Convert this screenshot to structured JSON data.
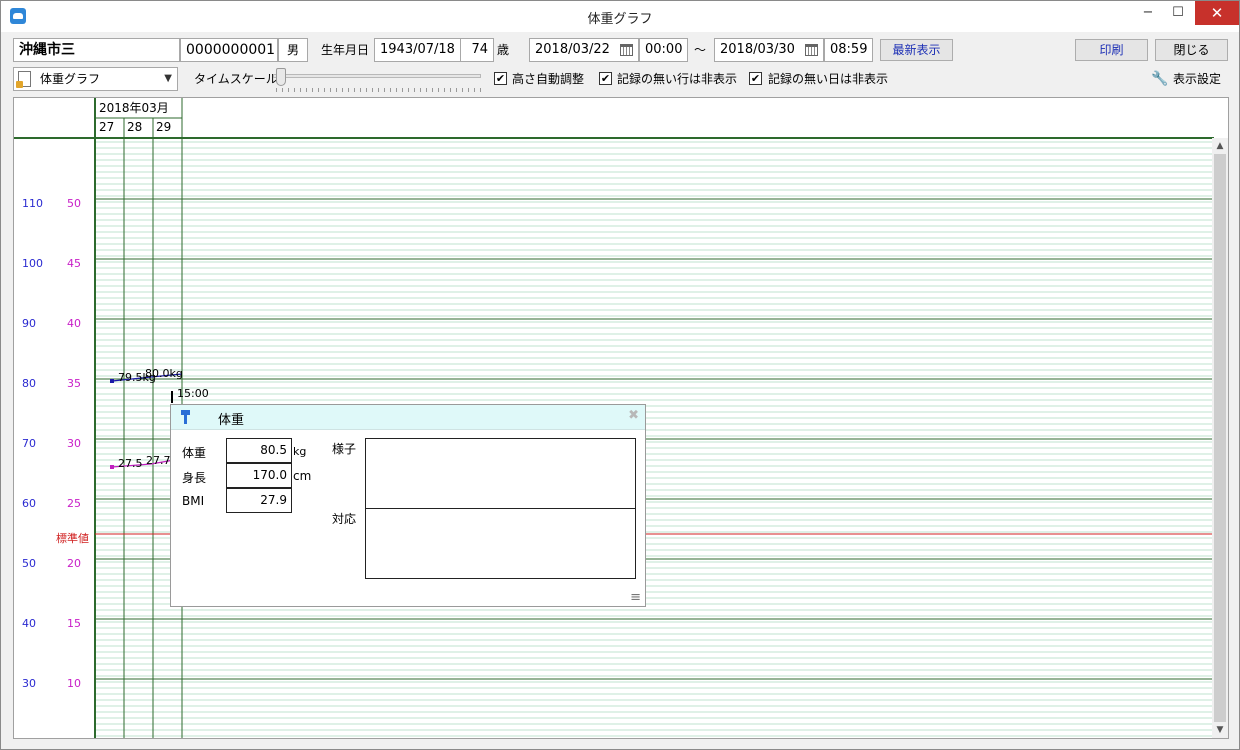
{
  "window": {
    "title": "体重グラフ",
    "minimize_glyph": "−",
    "maximize_glyph": "☐",
    "close_glyph": "✕"
  },
  "patient": {
    "name": "沖縄市三",
    "id": "0000000001",
    "sex": "男",
    "birth_label": "生年月日",
    "birth_date": "1943/07/18",
    "age": "74",
    "age_unit": "歳"
  },
  "range": {
    "start_date": "2018/03/22",
    "start_time": "00:00",
    "separator": "〜",
    "end_date": "2018/03/30",
    "end_time": "08:59"
  },
  "toolbar": {
    "refresh_label": "最新表示",
    "print_label": "印刷",
    "close_label": "閉じる",
    "view_select": "体重グラフ",
    "timescale_label": "タイムスケール",
    "auto_height_label": "高さ自動調整",
    "hide_empty_rows_label": "記録の無い行は非表示",
    "hide_empty_days_label": "記録の無い日は非表示",
    "display_settings_label": "表示設定"
  },
  "checkboxes": {
    "auto_height": true,
    "hide_empty_rows": true,
    "hide_empty_days": true
  },
  "chart": {
    "month_label": "2018年03月",
    "days": [
      "27",
      "28",
      "29"
    ],
    "left_axis": [
      "110",
      "100",
      "90",
      "80",
      "70",
      "60",
      "50",
      "40",
      "30"
    ],
    "right_axis": [
      "50",
      "45",
      "40",
      "35",
      "30",
      "25",
      "20",
      "15",
      "10"
    ],
    "standard_label": "標準値",
    "point_labels": {
      "weight_1": "79.5kg",
      "weight_2": "80.0kg",
      "bmi_1": "27.5",
      "bmi_2": "27.7"
    },
    "time_marker": "15:00",
    "colors": {
      "weight": "#1a1aa8",
      "bmi": "#c020c0",
      "standard": "#d02020",
      "major_grid": "#2d6a2d",
      "minor_grid": "#bfe3cf",
      "left_axis": "#2a2ad0",
      "right_axis": "#c81fc8"
    }
  },
  "popup": {
    "title": "体重",
    "close_glyph": "✖",
    "weight_label": "体重",
    "weight_value": "80.5",
    "weight_unit": "kg",
    "height_label": "身長",
    "height_value": "170.0",
    "height_unit": "cm",
    "bmi_label": "BMI",
    "bmi_value": "27.9",
    "condition_label": "様子",
    "response_label": "対応",
    "menu_glyph": "≡"
  }
}
